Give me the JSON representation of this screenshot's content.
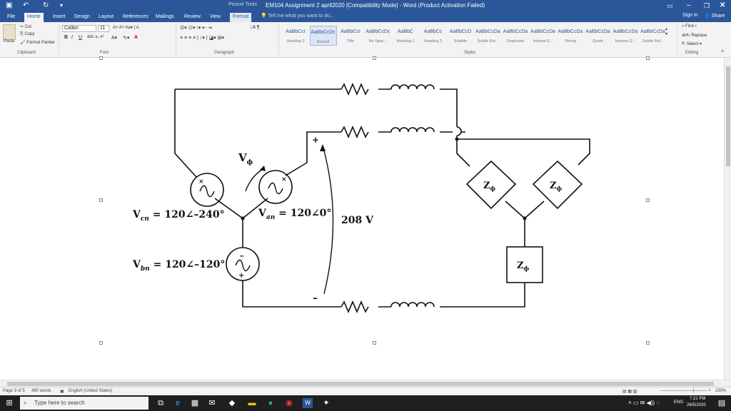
{
  "window": {
    "context_tab": "Picture Tools",
    "title": "EM104 Assignment 2 april2020 [Compatibility Mode] - Word (Product Activation Failed)"
  },
  "tabs": [
    "File",
    "Home",
    "Insert",
    "Design",
    "Layout",
    "References",
    "Mailings",
    "Review",
    "View",
    "Format"
  ],
  "tell_me": "Tell me what you want to do...",
  "account": {
    "signin": "Sign in",
    "share": "Share"
  },
  "ribbon": {
    "clipboard": {
      "paste": "Paste",
      "cut": "Cut",
      "copy": "Copy",
      "format_painter": "Format Painter",
      "label": "Clipboard"
    },
    "font": {
      "name": "Calibri",
      "size": "11",
      "label": "Font"
    },
    "paragraph": {
      "label": "Paragraph"
    },
    "styles": {
      "label": "Styles",
      "items": [
        {
          "sample": "AaBbCcI",
          "name": "Heading 2"
        },
        {
          "sample": "AaBbCcDc",
          "name": "Normal"
        },
        {
          "sample": "AaBbCcI",
          "name": "Title"
        },
        {
          "sample": "AaBbCcDc",
          "name": "No Spac..."
        },
        {
          "sample": "AaBbC",
          "name": "Heading 1"
        },
        {
          "sample": "AaBbCc",
          "name": "Heading 3"
        },
        {
          "sample": "AaBbCcD",
          "name": "Subtitle"
        },
        {
          "sample": "AaBbCcDa",
          "name": "Subtle Em..."
        },
        {
          "sample": "AaBbCcDa",
          "name": "Emphasis"
        },
        {
          "sample": "AaBbCcDa",
          "name": "Intense E..."
        },
        {
          "sample": "AaBbCcDa",
          "name": "Strong"
        },
        {
          "sample": "AaBbCcDa",
          "name": "Quote"
        },
        {
          "sample": "AaBbCcDa",
          "name": "Intense Q..."
        },
        {
          "sample": "AaBbCcDa",
          "name": "Subtle Ref..."
        }
      ]
    },
    "editing": {
      "find": "Find",
      "replace": "Replace",
      "select": "Select",
      "label": "Editing"
    }
  },
  "circuit": {
    "v_phase": "V",
    "v_phase_sub": "ϕ",
    "vcn": "V",
    "vcn_sub": "cn",
    "vcn_value": " = 120∠–240°",
    "van": "V",
    "van_sub": "an",
    "van_value": " = 120∠0°",
    "vbn": "V",
    "vbn_sub": "bn",
    "vbn_value": " = 120∠–120°",
    "line_voltage": "208 V",
    "plus": "+",
    "minus": "–",
    "z": "Z",
    "z_sub": "ϕ"
  },
  "status": {
    "page": "Page 3 of 5",
    "words": "480 words",
    "language": "English (United States)",
    "zoom": "230%"
  },
  "taskbar": {
    "search_placeholder": "Type here to search",
    "lang": "ENG",
    "time": "7:21 PM",
    "date": "26/5/2020"
  },
  "colors": {
    "accent": "#2b579a",
    "taskbar": "#1f1f1f"
  }
}
